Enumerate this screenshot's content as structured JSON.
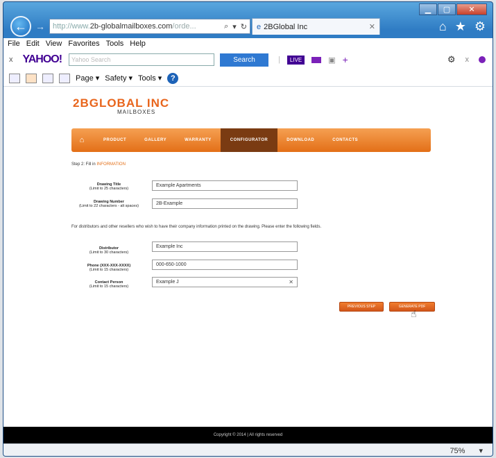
{
  "browser": {
    "address": {
      "prefix": "http://www.",
      "domain": "2b-globalmailboxes.com",
      "suffix": "/orde..."
    },
    "tab_title": "2BGlobal Inc",
    "menu": [
      "File",
      "Edit",
      "View",
      "Favorites",
      "Tools",
      "Help"
    ],
    "yahoo": {
      "logo": "YAHOO!",
      "search_placeholder": "Yahoo Search",
      "search_button": "Search",
      "live": "LIVE"
    },
    "commands": {
      "page": "Page ▾",
      "safety": "Safety ▾",
      "tools": "Tools ▾",
      "help": "?"
    },
    "zoom": "75%"
  },
  "site": {
    "logo_top": "2BGLOBAL INC",
    "logo_sub": "MAILBOXES",
    "nav": [
      "PRODUCT",
      "GALLERY",
      "WARRANTY",
      "CONFIGURATOR",
      "DOWNLOAD",
      "CONTACTS"
    ],
    "step_prefix": "Step 2: Fill in ",
    "step_highlight": "INFORMATION",
    "fields": [
      {
        "label": "Drawing Title",
        "hint": "(Limit to 25 characters)",
        "value": "Example Apartments"
      },
      {
        "label": "Drawing Number",
        "hint": "(Limit to 22 characters - alt spaces)",
        "value": "2B-Example"
      }
    ],
    "notice": "For distributors and other resellers who wish to have their company information printed on the drawing. Please enter the following fields.",
    "dealer_fields": [
      {
        "label": "Distributor",
        "hint": "(Limit to 30 characters)",
        "value": "Example Inc"
      },
      {
        "label": "Phone (XXX-XXX-XXXX)",
        "hint": "(Limit to 15 characters)",
        "value": "000-650-1000"
      },
      {
        "label": "Contact Person",
        "hint": "(Limit to 15 characters)",
        "value": "Example J"
      }
    ],
    "previous_button": "PREVIOUS STEP",
    "generate_button": "GENERATE PDF",
    "footer": "Copyright © 2014 | All rights reserved"
  }
}
